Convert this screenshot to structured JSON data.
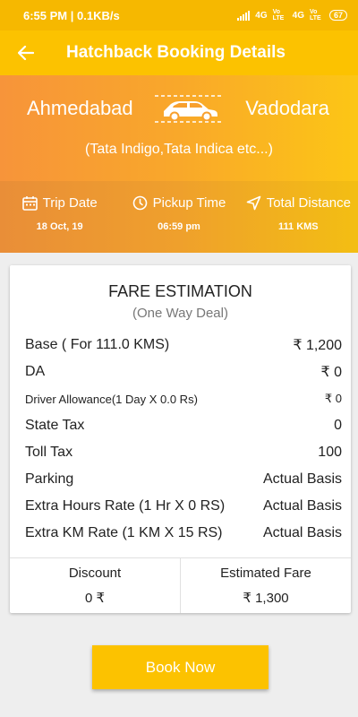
{
  "status_bar": {
    "time_speed": "6:55 PM | 0.1KB/s",
    "network": "4G",
    "volte1": "Vo LTE",
    "network2": "4G",
    "volte2": "Vo LTE",
    "battery": "67"
  },
  "app_bar": {
    "title": "Hatchback Booking Details",
    "back_icon": "arrow-left-icon"
  },
  "route": {
    "from": "Ahmedabad",
    "to": "Vadodara",
    "vehicles": "(Tata Indigo,Tata Indica etc...)",
    "icon": "car-icon"
  },
  "trip": {
    "date_label": "Trip Date",
    "date_value": "18 Oct, 19",
    "time_label": "Pickup Time",
    "time_value": "06:59 pm",
    "distance_label": "Total Distance",
    "distance_value": "111 KMS"
  },
  "fare": {
    "title": "FARE ESTIMATION",
    "subtitle": "(One Way Deal)",
    "rows": [
      {
        "label": "Base ( For 111.0 KMS)",
        "value": "₹ 1,200"
      },
      {
        "label": "DA",
        "value": "₹ 0"
      },
      {
        "label": "Driver Allowance(1 Day X 0.0 Rs)",
        "value": "₹ 0"
      },
      {
        "label": "State Tax",
        "value": "0"
      },
      {
        "label": "Toll Tax",
        "value": "100"
      },
      {
        "label": "Parking",
        "value": "Actual Basis"
      },
      {
        "label": "Extra Hours Rate (1 Hr X 0 RS)",
        "value": "Actual Basis"
      },
      {
        "label": "Extra KM Rate (1 KM X 15 RS)",
        "value": "Actual Basis"
      }
    ],
    "discount_label": "Discount",
    "discount_value": "0 ₹",
    "estimated_label": "Estimated Fare",
    "estimated_value": "₹ 1,300"
  },
  "book_button": {
    "label": "Book Now"
  },
  "colors": {
    "primary": "#fcc200",
    "status_bar": "#f6b800",
    "gradient_start": "#f7943a",
    "gradient_end": "#fcc615"
  }
}
